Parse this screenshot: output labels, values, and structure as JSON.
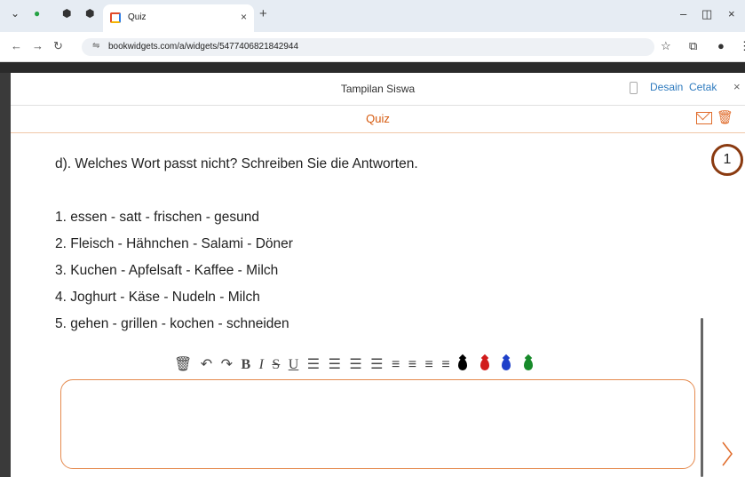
{
  "browser": {
    "tab_title": "Quiz",
    "url": "bookwidgets.com/a/widgets/5477406821842944"
  },
  "modal": {
    "view_title": "Tampilan Siswa",
    "design_link": "Desain",
    "print_link": "Cetak",
    "close": "×",
    "quiz_title": "Quiz",
    "question_number": "1"
  },
  "question": {
    "prompt": "d). Welches Wort passt nicht? Schreiben Sie die Antworten.",
    "items": [
      "1. essen - satt - frischen - gesund",
      "2. Fleisch - Hähnchen - Salami - Döner",
      "3. Kuchen - Apfelsaft - Kaffee - Milch",
      "4. Joghurt - Käse - Nudeln - Milch",
      "5. gehen - grillen - kochen - schneiden"
    ]
  },
  "toolbar": {
    "bold": "B",
    "italic": "I",
    "strike": "S",
    "underline": "U",
    "colors": [
      "#000000",
      "#d11b1b",
      "#1e40c9",
      "#178a2a"
    ]
  },
  "answer": {
    "value": ""
  }
}
